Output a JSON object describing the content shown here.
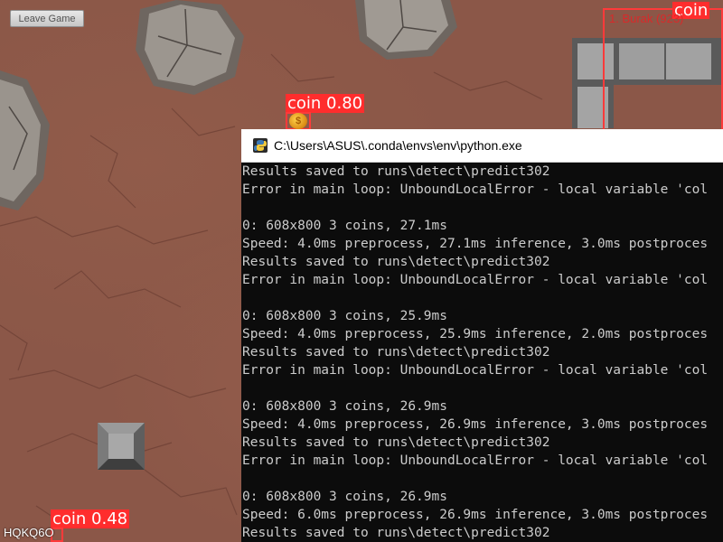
{
  "game": {
    "leave_button": "Leave Game",
    "player_label": "1. Burak (923)",
    "player_id": "HQKQ6O",
    "detections": [
      {
        "label": "coin 0.80"
      },
      {
        "label": "coin"
      },
      {
        "label": "coin 0.48"
      }
    ],
    "coin_symbol": "$"
  },
  "console": {
    "title": "C:\\Users\\ASUS\\.conda\\envs\\env\\python.exe",
    "lines": [
      "Results saved to runs\\detect\\predict302",
      "Error in main loop: UnboundLocalError - local variable 'col",
      "",
      "0: 608x800 3 coins, 27.1ms",
      "Speed: 4.0ms preprocess, 27.1ms inference, 3.0ms postproces",
      "Results saved to runs\\detect\\predict302",
      "Error in main loop: UnboundLocalError - local variable 'col",
      "",
      "0: 608x800 3 coins, 25.9ms",
      "Speed: 4.0ms preprocess, 25.9ms inference, 2.0ms postproces",
      "Results saved to runs\\detect\\predict302",
      "Error in main loop: UnboundLocalError - local variable 'col",
      "",
      "0: 608x800 3 coins, 26.9ms",
      "Speed: 4.0ms preprocess, 26.9ms inference, 3.0ms postproces",
      "Results saved to runs\\detect\\predict302",
      "Error in main loop: UnboundLocalError - local variable 'col",
      "",
      "0: 608x800 3 coins, 26.9ms",
      "Speed: 6.0ms preprocess, 26.9ms inference, 3.0ms postproces",
      "Results saved to runs\\detect\\predict302"
    ]
  },
  "colors": {
    "ground": "#8b5748",
    "detection_red": "#ff2d2d",
    "console_bg": "#0c0c0c",
    "console_text": "#cccccc"
  }
}
